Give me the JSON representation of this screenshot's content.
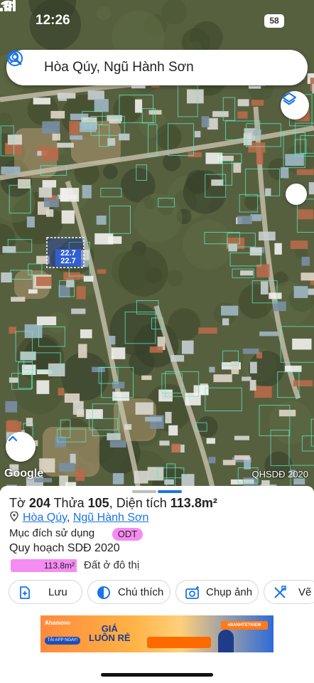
{
  "status_bar": {
    "time": "12:26",
    "battery": "58"
  },
  "search": {
    "text": "Hòa Qúy, Ngũ Hành Sơn"
  },
  "map": {
    "dimension_labels": [
      "22.7",
      "22.7"
    ],
    "logo": "Google",
    "layer_label": "QHSDĐ 2020"
  },
  "parcel": {
    "to_label": "Tờ",
    "to_number": "204",
    "thua_label": "Thửa",
    "thua_number": "105",
    "area_label": "Diện tích",
    "area_value": "113.8m²",
    "ward": "Hòa Qúy",
    "district": "Ngũ Hành Sơn",
    "purpose_label": "Mục đích sử dụng",
    "purpose_code": "ODT",
    "plan_title": "Quy hoạch SDĐ 2020",
    "plan_area": "113.8m²",
    "plan_desc": "Đất ở đô thị"
  },
  "actions": [
    {
      "label": "Lưu",
      "icon": "add-note-icon"
    },
    {
      "label": "Chú thích",
      "icon": "half-circle-icon"
    },
    {
      "label": "Chụp ảnh",
      "icon": "camera-icon"
    },
    {
      "label": "Vẽ",
      "icon": "draw-tools-icon"
    }
  ],
  "ad": {
    "brand": "Ahamove",
    "cta": "TẢI APP NGAY!",
    "promo_line1": "GIÁ",
    "promo_line2": "LUÔN RẺ",
    "tag": "#BANHTETKIEM"
  },
  "colors": {
    "accent": "#1a73e8",
    "odt_pink": "#f58cf2",
    "parcel_line": "#5ef0c8"
  }
}
